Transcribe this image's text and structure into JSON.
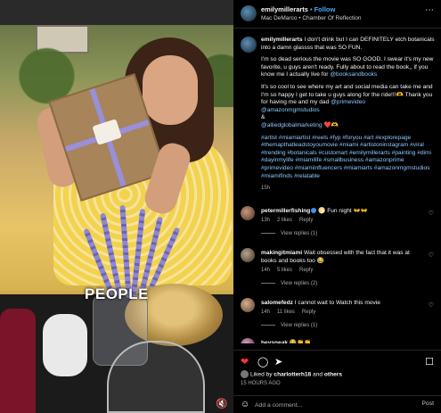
{
  "post": {
    "overlay_text": "PEOPLE"
  },
  "header": {
    "username": "emilymillerarts",
    "separator": "•",
    "follow_label": "Follow",
    "audio": "Mac DeMarco • Chamber Of Reflection"
  },
  "caption": {
    "username": "emilymillerarts",
    "p1": "I don't drink but I can DEFINITELY etch botanicals into a damn glassss that was SO FUN.",
    "p2a": "I'm so dead serious the movie was SO GOOD. I swear it's my new favorite, u guys aren't ready. Fully about to read the book,, if you know me I actually live for ",
    "p2_mention": "@booksandbooks",
    "p3a": "It's so cool to see where my art and social media can take me and I'm so happy I get to take u guys along for the ride!!!🫶 Thank you for having me and my dad ",
    "p3_mention1": "@primevideo",
    "p3_mention2": "@amazonmgmstudios",
    "p3_amp": "&",
    "p3_mention3": "@alliedglobalmarketing",
    "p3_tail": " ❤️🫶",
    "hashtags": "#artist #miamiartist #reels #fyp #foryou #art #explorepage #themapthatleadstoyoumovie #miami #artistoninstagram #viral #trending #botanicals #customart #emilymillerarts #painting #dimi #dayinmylife #miamilife #smallbusiness #amazonprime #primevideo #miamiinfluencers #miamiarts #amazonmgmstudios #miamifinds #relatable",
    "age": "15h"
  },
  "comments": [
    {
      "username": "petermillerfishing",
      "text": "🌕 Fun night 👐👐",
      "time": "13h",
      "likes": "2 likes",
      "reply": "Reply",
      "view_replies": "View replies (1)"
    },
    {
      "username": "makingitmiami",
      "text": "Wait obsessed with the fact that it was at books and books too 😂",
      "time": "14h",
      "likes": "5 likes",
      "reply": "Reply",
      "view_replies": "View replies (2)"
    },
    {
      "username": "salomefedz",
      "text": "I cannot wait to Watch this movie",
      "time": "14h",
      "likes": "11 likes",
      "reply": "Reply",
      "view_replies": "View replies (1)"
    },
    {
      "username": "heysneak",
      "text": "😂👏👏",
      "time": "",
      "likes": "",
      "reply": "",
      "view_replies": ""
    }
  ],
  "actions": {
    "like_icon": "heart-icon",
    "comment_icon": "comment-icon",
    "share_icon": "share-icon",
    "save_icon": "bookmark-icon"
  },
  "likes": {
    "prefix": "Liked by ",
    "user": "charlotterh18",
    "middle": " and ",
    "others": "others"
  },
  "time_ago": "15 HOURS AGO",
  "add_comment": {
    "placeholder": "Add a comment...",
    "post_label": "Post"
  },
  "colors": {
    "accent": "#4ba7f5",
    "like_red": "#ff3040",
    "background": "#000000"
  }
}
